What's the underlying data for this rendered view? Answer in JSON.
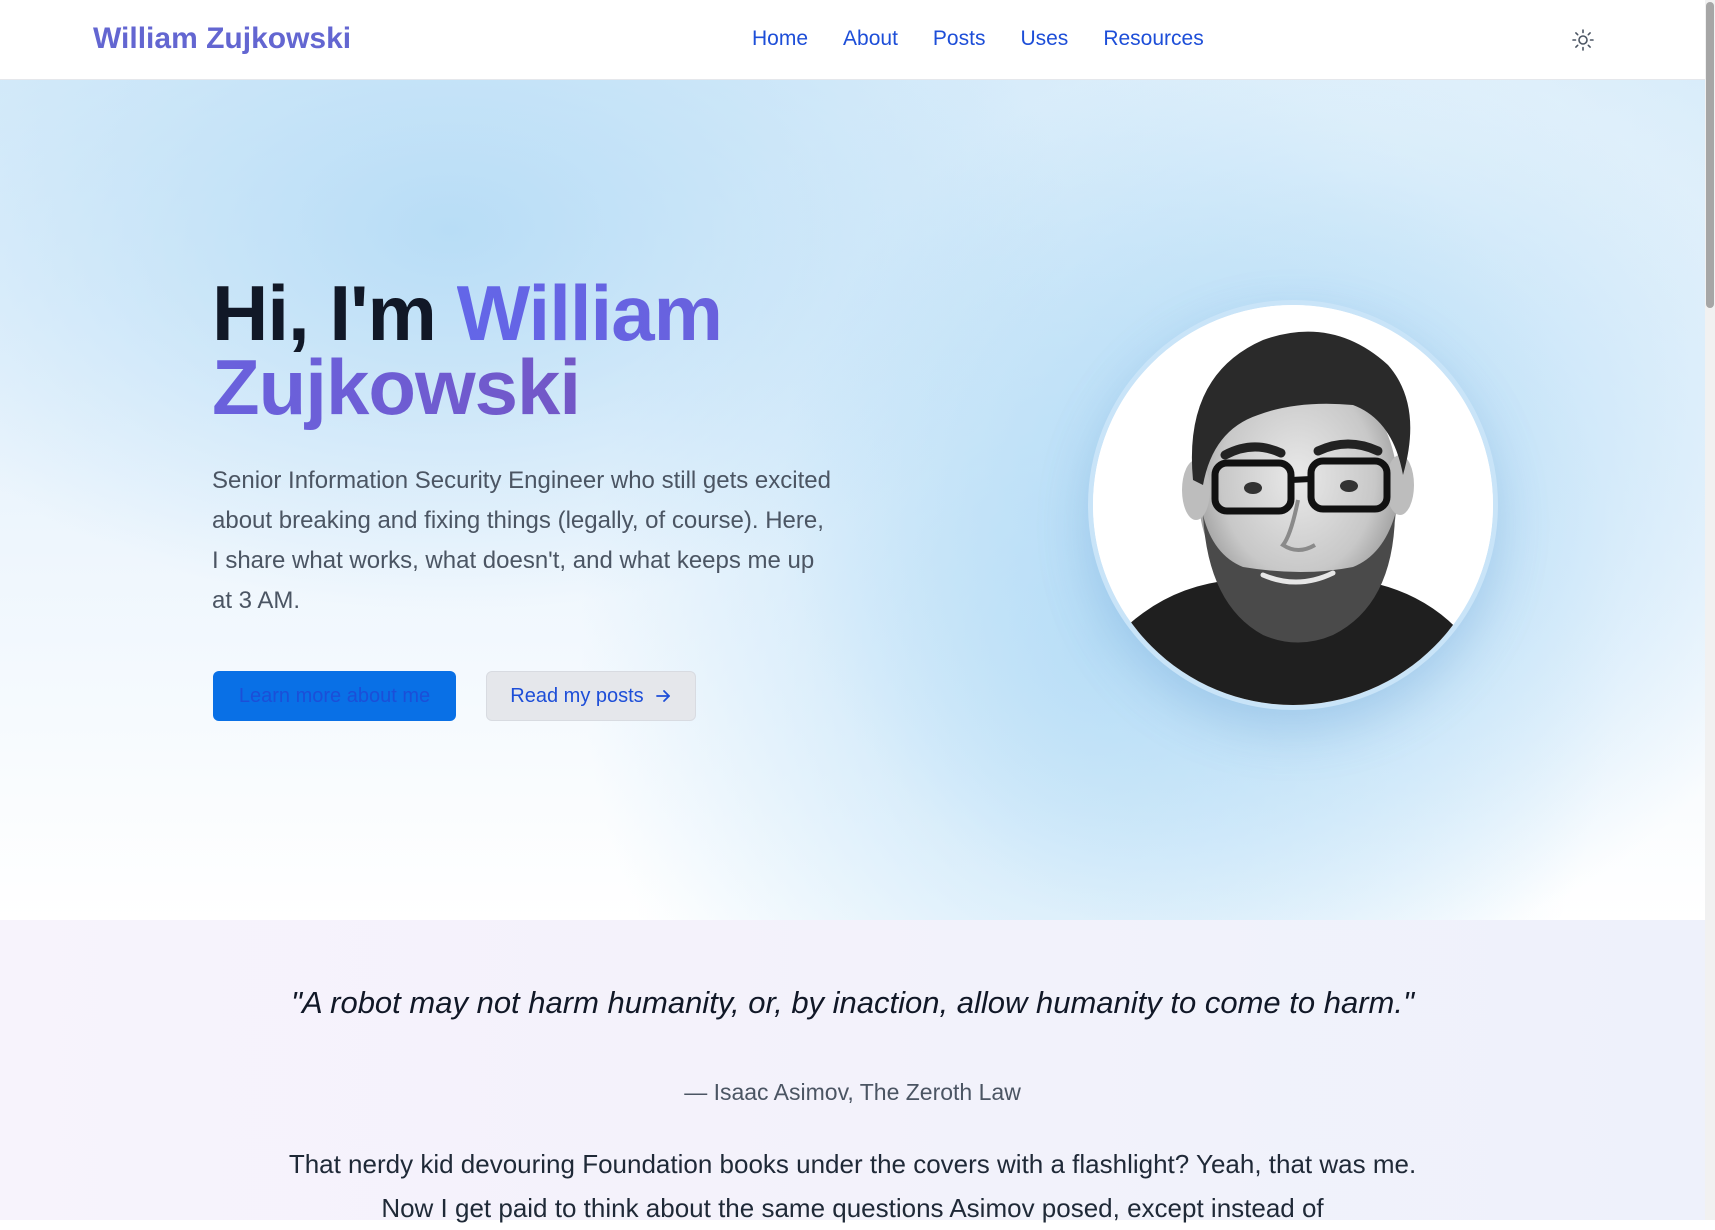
{
  "header": {
    "brand": "William Zujkowski",
    "nav": [
      "Home",
      "About",
      "Posts",
      "Uses",
      "Resources"
    ],
    "theme_toggle_icon": "sun-icon"
  },
  "hero": {
    "greeting": "Hi, I'm",
    "name": "William Zujkowski",
    "bio": "Senior Information Security Engineer who still gets excited about breaking and fixing things (legally, of course). Here, I share what works, what doesn't, and what keeps me up at 3 AM.",
    "primary_button": "Learn more about me",
    "secondary_button": "Read my posts",
    "secondary_button_icon": "arrow-right-icon",
    "avatar": "profile-photo"
  },
  "quote": {
    "text": "\"A robot may not harm humanity, or, by inaction, allow humanity to come to harm.\"",
    "attribution": "— Isaac Asimov, The Zeroth Law"
  },
  "story": {
    "text": "That nerdy kid devouring Foundation books under the covers with a flashlight? Yeah, that was me. Now I get paid to think about the same questions Asimov posed, except instead of"
  },
  "colors": {
    "brand": "#6366d1",
    "link": "#1d4ed8",
    "primary_button": "#0970e6"
  }
}
